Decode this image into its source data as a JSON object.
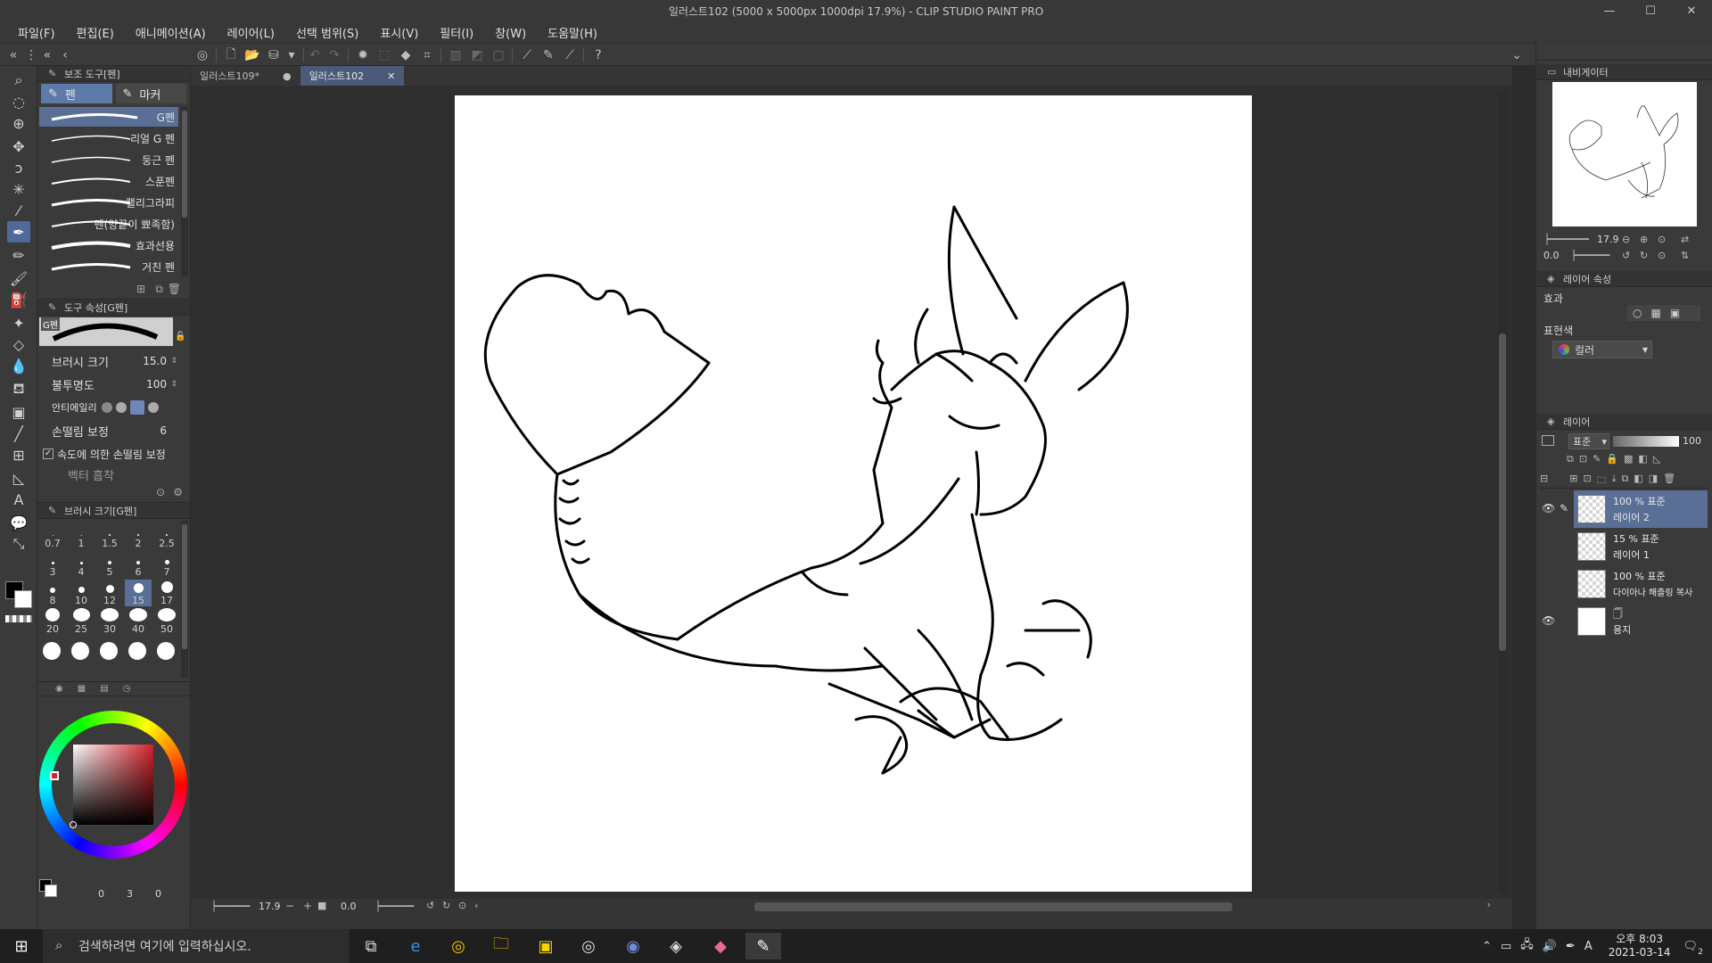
{
  "window": {
    "title": "일러스트102 (5000 x 5000px 1000dpi 17.9%)  - CLIP STUDIO PAINT PRO",
    "minimize": "—",
    "maximize": "☐",
    "close": "✕"
  },
  "menu": [
    "파일(F)",
    "편집(E)",
    "애니메이션(A)",
    "레이어(L)",
    "선택 범위(S)",
    "표시(V)",
    "필터(I)",
    "창(W)",
    "도움말(H)"
  ],
  "subtool_panel": {
    "title": "보조 도구[펜]",
    "tabs": [
      "펜",
      "마커"
    ],
    "brushes": [
      "G펜",
      "리얼 G 펜",
      "둥근 펜",
      "스푼펜",
      "캘리그라피",
      "펜(양끝이 뾰족함)",
      "효과선용",
      "거친 펜"
    ]
  },
  "tool_property": {
    "title": "도구 속성[G펜]",
    "preview_label": "G펜",
    "brush_size_label": "브러시 크기",
    "brush_size_value": "15.0",
    "opacity_label": "불투명도",
    "opacity_value": "100",
    "antialias_label": "안티에일리",
    "stabilization_label": "손떨림 보정",
    "stabilization_value": "6",
    "speed_stabilization_label": "속도에 의한 손떨림 보정",
    "vector_label": "벡터 흡착"
  },
  "brush_size_panel": {
    "title": "브러시 크기[G펜]",
    "sizes": [
      "0.7",
      "1",
      "1.5",
      "2",
      "2.5",
      "3",
      "4",
      "5",
      "6",
      "7",
      "8",
      "10",
      "12",
      "15",
      "17",
      "20",
      "25",
      "30",
      "40",
      "50"
    ],
    "selected": "15"
  },
  "color_panel": {
    "readout_left": "0",
    "readout_mid": "3",
    "readout_right": "0"
  },
  "doc_tabs": [
    {
      "label": "일러스트109*"
    },
    {
      "label": "일러스트102"
    }
  ],
  "canvas_status": {
    "zoom": "17.9",
    "angle": "0.0"
  },
  "navigator": {
    "title": "내비게이터",
    "zoom": "17.9",
    "angle": "0.0"
  },
  "layer_property": {
    "title": "레이어 속성",
    "effect_label": "효과",
    "expression_label": "표현색",
    "expression_value": "컬러"
  },
  "layers_panel": {
    "title": "레이어",
    "blend_mode": "표준",
    "opacity": "100",
    "layers": [
      {
        "line1": "100 % 표준",
        "line2": "레이어 2",
        "visible": true,
        "selected": true
      },
      {
        "line1": "15 % 표준",
        "line2": "레이어 1",
        "visible": false,
        "selected": false
      },
      {
        "line1": "100 % 표준",
        "line2": "다이아나 해츨링 복사",
        "visible": false,
        "selected": false
      },
      {
        "line1": "",
        "line2": "용지",
        "visible": true,
        "selected": false
      }
    ]
  },
  "taskbar": {
    "search_placeholder": "검색하려면 여기에 입력하십시오.",
    "ime": "A",
    "time_line1": "오후 8:03",
    "time_line2": "2021-03-14",
    "notification_count": "2"
  }
}
